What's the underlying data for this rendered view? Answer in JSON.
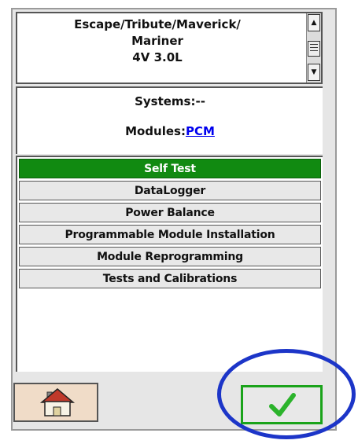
{
  "vehicle": {
    "line1": "Escape/Tribute/Maverick/",
    "line2": "Mariner",
    "line3": "4V 3.0L"
  },
  "info": {
    "systems_label": "Systems:--",
    "modules_label": "Modules:",
    "modules_link": "PCM"
  },
  "menu": {
    "items": [
      {
        "label": "Self Test",
        "selected": true
      },
      {
        "label": "DataLogger",
        "selected": false
      },
      {
        "label": "Power Balance",
        "selected": false
      },
      {
        "label": "Programmable Module Installation",
        "selected": false
      },
      {
        "label": "Module Reprogramming",
        "selected": false
      },
      {
        "label": "Tests and Calibrations",
        "selected": false
      }
    ]
  },
  "buttons": {
    "home_icon": "home-icon",
    "confirm_icon": "checkmark-icon"
  },
  "colors": {
    "selected_item": "#118a11",
    "confirm_border": "#1aa31a",
    "highlight_oval": "#1c35c8",
    "link": "#0000ee"
  }
}
